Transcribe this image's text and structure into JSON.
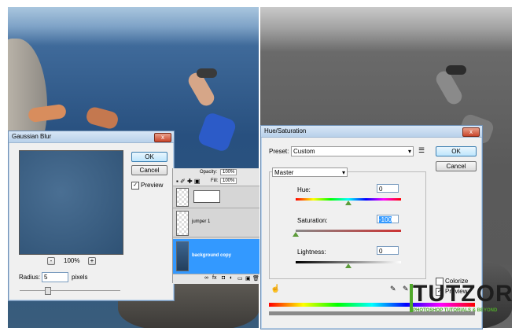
{
  "gaussian_blur": {
    "title": "Gaussian Blur",
    "close": "x",
    "ok_label": "OK",
    "cancel_label": "Cancel",
    "preview_label": "Preview",
    "preview_checked": "✓",
    "zoom_minus": "-",
    "zoom_level": "100%",
    "zoom_plus": "+",
    "radius_label": "Radius:",
    "radius_value": "5",
    "radius_unit": "pixels"
  },
  "layers_panel": {
    "opacity_label": "Opacity:",
    "opacity_value": "100%",
    "fill_label": "Fill:",
    "fill_value": "100%",
    "layers": [
      {
        "name": ""
      },
      {
        "name": "jumper 1"
      },
      {
        "name": "background copy"
      }
    ],
    "footer_icons": [
      "∞",
      "fx",
      "◘",
      "◐",
      "▭",
      "▣",
      "🗑"
    ]
  },
  "hue_saturation": {
    "title": "Hue/Saturation",
    "close": "x",
    "preset_label": "Preset:",
    "preset_value": "Custom",
    "ok_label": "OK",
    "cancel_label": "Cancel",
    "channel_value": "Master",
    "hue_label": "Hue:",
    "hue_value": "0",
    "saturation_label": "Saturation:",
    "saturation_value": "-100",
    "lightness_label": "Lightness:",
    "lightness_value": "0",
    "colorize_label": "Colorize",
    "preview_label": "Preview",
    "preview_checked": "✓"
  },
  "logo": {
    "name": "TUTZOR",
    "tagline": "PHOTOSHOP TUTORIALS & BEYOND"
  },
  "colors": {
    "selection_blue": "#3399ff",
    "logo_green": "#4fa82a"
  }
}
